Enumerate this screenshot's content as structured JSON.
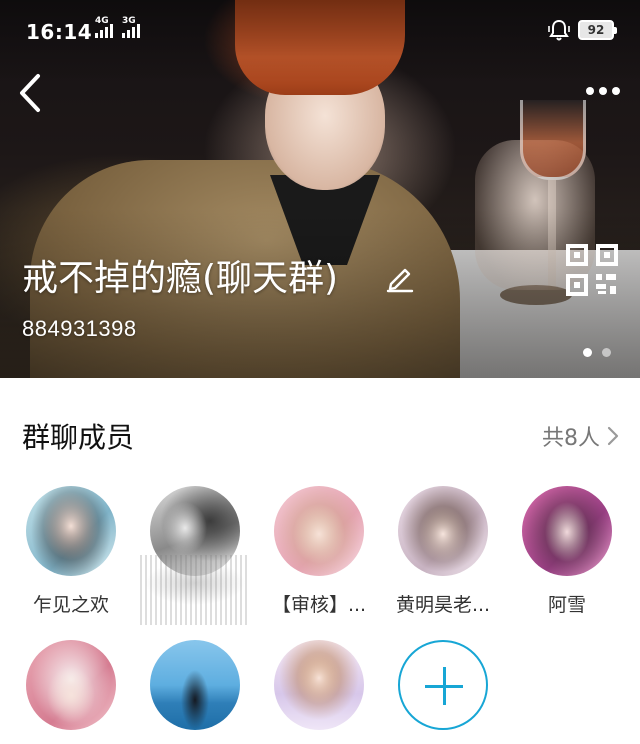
{
  "status_bar": {
    "time": "16:14",
    "network_1": "4G",
    "network_2": "3G",
    "battery": "92"
  },
  "header": {
    "group_name": "戒不掉的瘾(聊天群)",
    "group_id": "884931398",
    "pager_count": 2,
    "pager_active": 0,
    "icons": {
      "back": "back-icon",
      "more": "more-icon",
      "edit": "edit-icon",
      "qr": "qr-code-icon"
    }
  },
  "members": {
    "title": "群聊成员",
    "count_label": "共8人",
    "list": [
      {
        "name": "乍见之欢"
      },
      {
        "name": ""
      },
      {
        "name": "【审核】..."
      },
      {
        "name": "黄明昊老..."
      },
      {
        "name": "阿雪"
      },
      {
        "name": ""
      },
      {
        "name": ""
      },
      {
        "name": ""
      }
    ],
    "add_icon": "add-icon"
  },
  "colors": {
    "accent": "#17a6d5",
    "title_text": "#111111",
    "secondary_text": "#777777"
  }
}
